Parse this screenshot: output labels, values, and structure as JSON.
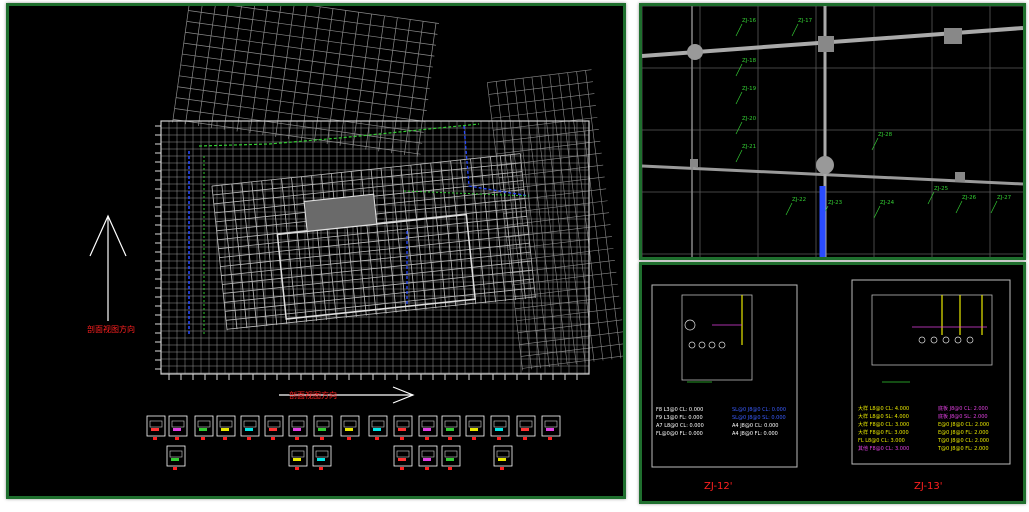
{
  "colors": {
    "background": "#000000",
    "panel_border": "#1f6f2e",
    "annotation_red": "#ff2020",
    "grid_gray": "#8c8c8c",
    "rebar_green": "#33cc33",
    "rebar_blue": "#2a4cff",
    "yellow": "#e8e800",
    "cyan": "#00e5e5",
    "magenta": "#e040e0"
  },
  "main_panel": {
    "direction_label_vertical": "剖面视图方向",
    "direction_label_horizontal": "剖面视图方向",
    "thumbnail_count_row1": 18,
    "thumbnail_count_row2": 6
  },
  "zoom_panel": {
    "labels": [
      "ZJ-16",
      "ZJ-17",
      "ZJ-18",
      "ZJ-19",
      "ZJ-20",
      "ZJ-21",
      "ZJ-22",
      "ZJ-23",
      "ZJ-24",
      "ZJ-25",
      "ZJ-26",
      "ZJ-27",
      "ZJ-28"
    ]
  },
  "sections_panel": {
    "left_title": "ZJ-12'",
    "right_title": "ZJ-13'",
    "left_notes": [
      "F8  L3@0  CL: 0.000",
      "F9  L3@0  FL: 0.000",
      "A7  L8@0  CL: 0.000",
      "FL@0@0  FL: 0.000"
    ],
    "left_notes_blue": [
      "SL@0 J8@0 CL: 0.000",
      "SL@0 J8@0 SL: 0.000",
      "A4  J8@0 CL: 0.000",
      "A4  J8@0 FL: 0.000"
    ],
    "right_notes_yellow": [
      "大样  L8@0  CL: 4.000",
      "大样  L8@0  SL: 4.000",
      "大样  F8@0  CL: 3.000",
      "大样  F8@0  FL: 3.000",
      "FL  L8@0  CL: 3.000",
      "其他  F8@0  CL: 3.000"
    ],
    "right_notes_right": [
      "底板 J8@0 CL: 2.000",
      "底板 J8@0 SL: 2.000",
      "E@0 J8@0 CL: 2.000",
      "E@0 J8@0 FL: 2.000",
      "T@0 J8@0 CL: 2.000",
      "T@0 J8@0 FL: 2.000"
    ]
  }
}
